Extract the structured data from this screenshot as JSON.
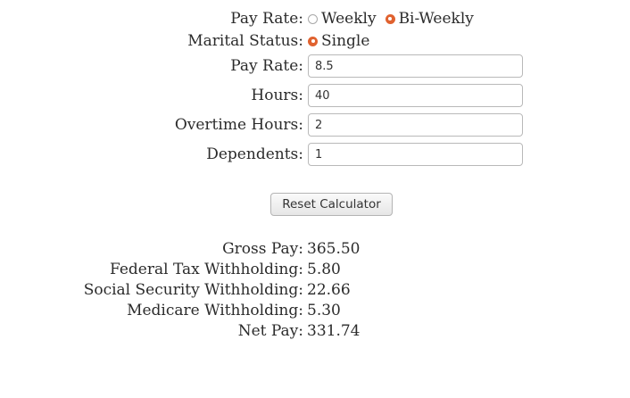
{
  "form": {
    "pay_rate_type_label": "Pay Rate:",
    "pay_rate_options": {
      "weekly": "Weekly",
      "biweekly": "Bi-Weekly",
      "selected": "Bi-Weekly"
    },
    "marital_status_label": "Marital Status:",
    "marital_options": {
      "single": "Single",
      "selected": "Single"
    },
    "pay_rate_label": "Pay Rate:",
    "pay_rate_value": "8.5",
    "hours_label": "Hours:",
    "hours_value": "40",
    "overtime_label": "Overtime Hours:",
    "overtime_value": "2",
    "dependents_label": "Dependents:",
    "dependents_value": "1",
    "reset_label": "Reset Calculator"
  },
  "results": {
    "gross_pay_label": "Gross Pay:",
    "gross_pay_value": "365.50",
    "federal_tax_label": "Federal Tax Withholding:",
    "federal_tax_value": "5.80",
    "social_security_label": "Social Security Withholding:",
    "social_security_value": "22.66",
    "medicare_label": "Medicare Withholding:",
    "medicare_value": "5.30",
    "net_pay_label": "Net Pay:",
    "net_pay_value": "331.74"
  },
  "colors": {
    "radio_selected": "#e0622f",
    "text": "#2b2b2b"
  }
}
